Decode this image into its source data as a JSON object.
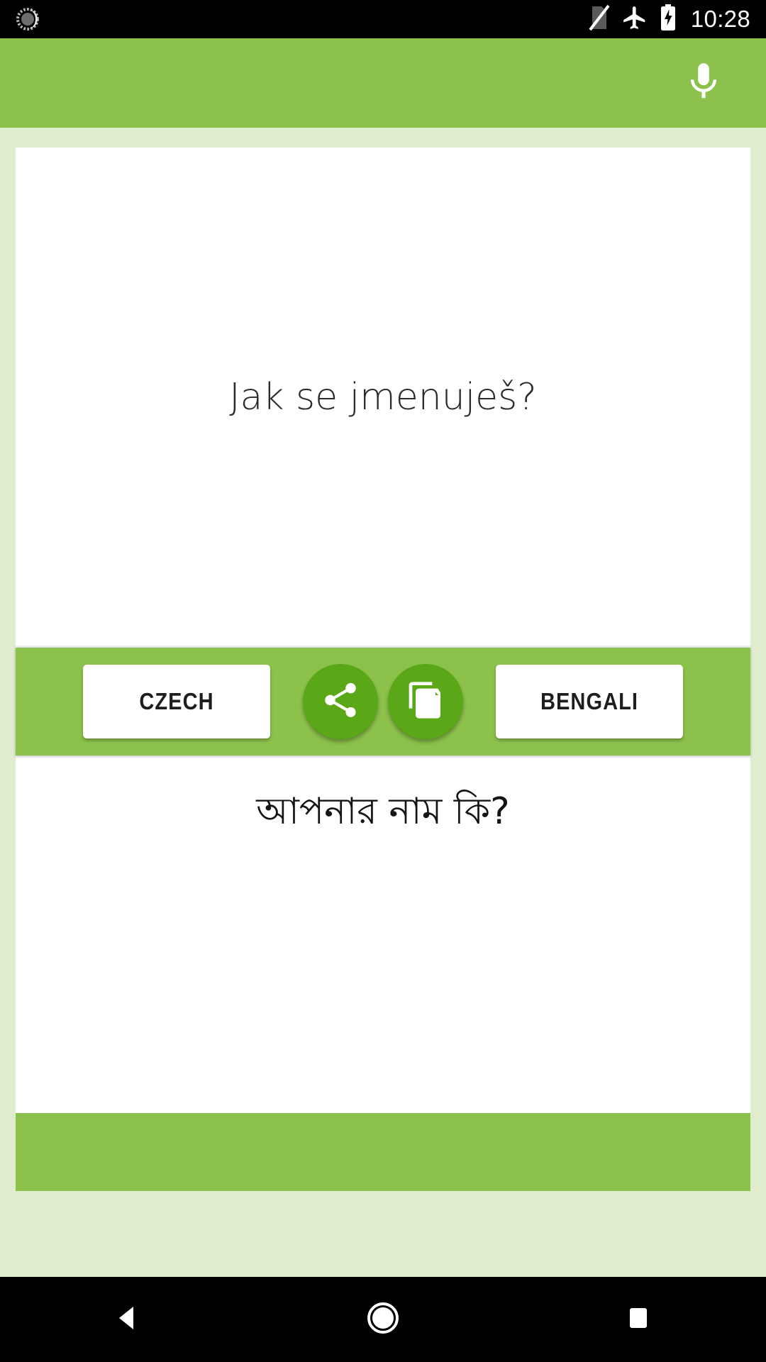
{
  "status_bar": {
    "notification_icon": "alarm-clock-icon",
    "icons": [
      "no-sim-icon",
      "airplane-mode-icon",
      "battery-charging-icon"
    ],
    "clock": "10:28"
  },
  "app_bar": {
    "mic_icon": "microphone-icon",
    "background_color": "#8cc24b"
  },
  "translation": {
    "source": {
      "language": "CZECH",
      "text": "Jak se jmenuješ?"
    },
    "target": {
      "language": "BENGALI",
      "text": "আপনার নাম কি?"
    },
    "actions": [
      {
        "name": "share-button",
        "icon": "share-icon"
      },
      {
        "name": "copy-button",
        "icon": "copy-icon"
      }
    ],
    "accent_color": "#5aa717"
  },
  "nav_bar": {
    "buttons": [
      {
        "name": "back-button",
        "icon": "back-triangle-icon"
      },
      {
        "name": "home-button",
        "icon": "home-circle-icon"
      },
      {
        "name": "recents-button",
        "icon": "recents-square-icon"
      }
    ]
  }
}
